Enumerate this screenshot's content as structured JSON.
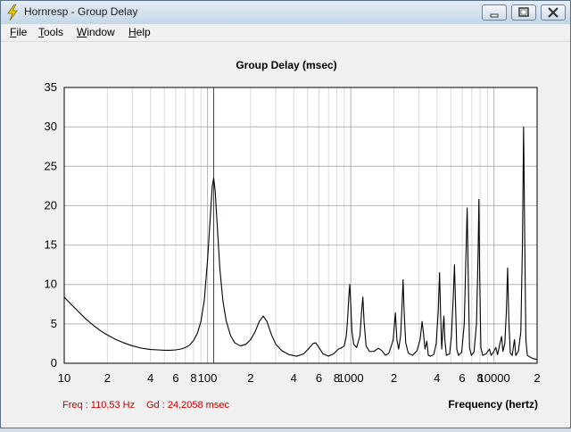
{
  "window": {
    "title": "Hornresp - Group Delay"
  },
  "menu": {
    "items": [
      {
        "label": "File",
        "accel": "F"
      },
      {
        "label": "Tools",
        "accel": "T"
      },
      {
        "label": "Window",
        "accel": "W"
      },
      {
        "label": "Help",
        "accel": "H"
      }
    ]
  },
  "status": {
    "freq": "Freq : 110,53 Hz",
    "gd": "Gd : 24,2058 msec",
    "color": "#c00000"
  },
  "chart_data": {
    "type": "line",
    "title": "Group Delay (msec)",
    "xlabel": "Frequency (hertz)",
    "ylabel": "",
    "x_scale": "log",
    "xlim": [
      10,
      20000
    ],
    "ylim": [
      0,
      35
    ],
    "y_ticks": [
      0,
      5,
      10,
      15,
      20,
      25,
      30,
      35
    ],
    "x_tick_labels": [
      {
        "x": 10,
        "label": "10"
      },
      {
        "x": 20,
        "label": "2"
      },
      {
        "x": 40,
        "label": "4"
      },
      {
        "x": 60,
        "label": "6"
      },
      {
        "x": 80,
        "label": "8"
      },
      {
        "x": 100,
        "label": "100"
      },
      {
        "x": 200,
        "label": "2"
      },
      {
        "x": 400,
        "label": "4"
      },
      {
        "x": 600,
        "label": "6"
      },
      {
        "x": 800,
        "label": "8"
      },
      {
        "x": 1000,
        "label": "1000"
      },
      {
        "x": 2000,
        "label": "2"
      },
      {
        "x": 4000,
        "label": "4"
      },
      {
        "x": 6000,
        "label": "6"
      },
      {
        "x": 8000,
        "label": "8"
      },
      {
        "x": 10000,
        "label": "10000"
      },
      {
        "x": 20000,
        "label": "2"
      }
    ],
    "grid": true,
    "cursor_x": 110.53,
    "cursor_color": "#cc0000",
    "line_color": "#000000",
    "series": [
      {
        "values": [
          [
            10,
            8.4
          ],
          [
            11,
            7.6
          ],
          [
            12.5,
            6.6
          ],
          [
            14,
            5.7
          ],
          [
            16,
            4.8
          ],
          [
            18,
            4.1
          ],
          [
            20,
            3.6
          ],
          [
            23,
            3.0
          ],
          [
            26,
            2.6
          ],
          [
            30,
            2.2
          ],
          [
            35,
            1.9
          ],
          [
            40,
            1.75
          ],
          [
            45,
            1.7
          ],
          [
            50,
            1.65
          ],
          [
            55,
            1.65
          ],
          [
            60,
            1.7
          ],
          [
            65,
            1.8
          ],
          [
            70,
            2.0
          ],
          [
            75,
            2.3
          ],
          [
            80,
            2.9
          ],
          [
            85,
            3.8
          ],
          [
            90,
            5.3
          ],
          [
            95,
            8.0
          ],
          [
            100,
            13.0
          ],
          [
            105,
            19.0
          ],
          [
            108,
            22.5
          ],
          [
            110.5,
            23.5
          ],
          [
            113,
            22.0
          ],
          [
            117,
            17.5
          ],
          [
            122,
            12.0
          ],
          [
            128,
            8.0
          ],
          [
            135,
            5.4
          ],
          [
            145,
            3.5
          ],
          [
            155,
            2.6
          ],
          [
            170,
            2.2
          ],
          [
            185,
            2.4
          ],
          [
            200,
            3.0
          ],
          [
            215,
            4.0
          ],
          [
            230,
            5.3
          ],
          [
            245,
            6.0
          ],
          [
            260,
            5.3
          ],
          [
            280,
            3.6
          ],
          [
            300,
            2.4
          ],
          [
            330,
            1.6
          ],
          [
            370,
            1.1
          ],
          [
            420,
            0.9
          ],
          [
            470,
            1.2
          ],
          [
            510,
            1.9
          ],
          [
            545,
            2.5
          ],
          [
            570,
            2.6
          ],
          [
            600,
            2.0
          ],
          [
            640,
            1.2
          ],
          [
            700,
            0.9
          ],
          [
            760,
            1.2
          ],
          [
            820,
            1.8
          ],
          [
            870,
            2.0
          ],
          [
            900,
            2.2
          ],
          [
            930,
            3.4
          ],
          [
            950,
            5.5
          ],
          [
            970,
            8.5
          ],
          [
            985,
            10.0
          ],
          [
            1000,
            7.5
          ],
          [
            1020,
            4.0
          ],
          [
            1050,
            2.4
          ],
          [
            1100,
            2.0
          ],
          [
            1160,
            3.5
          ],
          [
            1190,
            6.5
          ],
          [
            1215,
            8.4
          ],
          [
            1240,
            5.2
          ],
          [
            1280,
            2.2
          ],
          [
            1350,
            1.5
          ],
          [
            1450,
            1.5
          ],
          [
            1560,
            1.9
          ],
          [
            1650,
            1.6
          ],
          [
            1750,
            1.0
          ],
          [
            1850,
            1.3
          ],
          [
            1980,
            3.0
          ],
          [
            2050,
            6.4
          ],
          [
            2100,
            3.0
          ],
          [
            2160,
            1.8
          ],
          [
            2230,
            3.5
          ],
          [
            2290,
            8.0
          ],
          [
            2320,
            10.6
          ],
          [
            2360,
            6.5
          ],
          [
            2420,
            2.6
          ],
          [
            2520,
            1.3
          ],
          [
            2700,
            1.0
          ],
          [
            2900,
            1.6
          ],
          [
            3050,
            3.0
          ],
          [
            3150,
            5.3
          ],
          [
            3220,
            3.8
          ],
          [
            3300,
            1.8
          ],
          [
            3400,
            2.8
          ],
          [
            3480,
            1.0
          ],
          [
            3600,
            0.9
          ],
          [
            3800,
            1.1
          ],
          [
            3950,
            2.5
          ],
          [
            4080,
            6.5
          ],
          [
            4170,
            11.5
          ],
          [
            4240,
            6.2
          ],
          [
            4320,
            1.8
          ],
          [
            4400,
            4.3
          ],
          [
            4470,
            6.0
          ],
          [
            4540,
            3.0
          ],
          [
            4650,
            1.0
          ],
          [
            4900,
            1.2
          ],
          [
            5050,
            3.5
          ],
          [
            5200,
            8.5
          ],
          [
            5300,
            12.5
          ],
          [
            5400,
            7.0
          ],
          [
            5500,
            1.8
          ],
          [
            5650,
            1.0
          ],
          [
            5950,
            1.4
          ],
          [
            6200,
            5.0
          ],
          [
            6400,
            15.0
          ],
          [
            6500,
            19.7
          ],
          [
            6600,
            12.0
          ],
          [
            6750,
            2.0
          ],
          [
            6950,
            1.0
          ],
          [
            7250,
            1.4
          ],
          [
            7550,
            5.0
          ],
          [
            7750,
            14.0
          ],
          [
            7850,
            20.8
          ],
          [
            7950,
            11.0
          ],
          [
            8100,
            2.0
          ],
          [
            8350,
            1.0
          ],
          [
            8800,
            1.2
          ],
          [
            9300,
            1.8
          ],
          [
            9550,
            1.0
          ],
          [
            9900,
            1.4
          ],
          [
            10300,
            2.0
          ],
          [
            10600,
            1.1
          ],
          [
            11000,
            2.5
          ],
          [
            11300,
            3.4
          ],
          [
            11550,
            1.5
          ],
          [
            11900,
            2.5
          ],
          [
            12200,
            6.5
          ],
          [
            12450,
            12.1
          ],
          [
            12700,
            5.5
          ],
          [
            13000,
            1.3
          ],
          [
            13400,
            1.0
          ],
          [
            13900,
            3.0
          ],
          [
            14200,
            1.0
          ],
          [
            14800,
            1.5
          ],
          [
            15400,
            4.0
          ],
          [
            15800,
            15.0
          ],
          [
            16100,
            30.0
          ],
          [
            16400,
            15.5
          ],
          [
            16700,
            3.0
          ],
          [
            17100,
            1.0
          ],
          [
            17800,
            0.8
          ],
          [
            18700,
            0.6
          ],
          [
            20000,
            0.5
          ]
        ]
      }
    ]
  }
}
